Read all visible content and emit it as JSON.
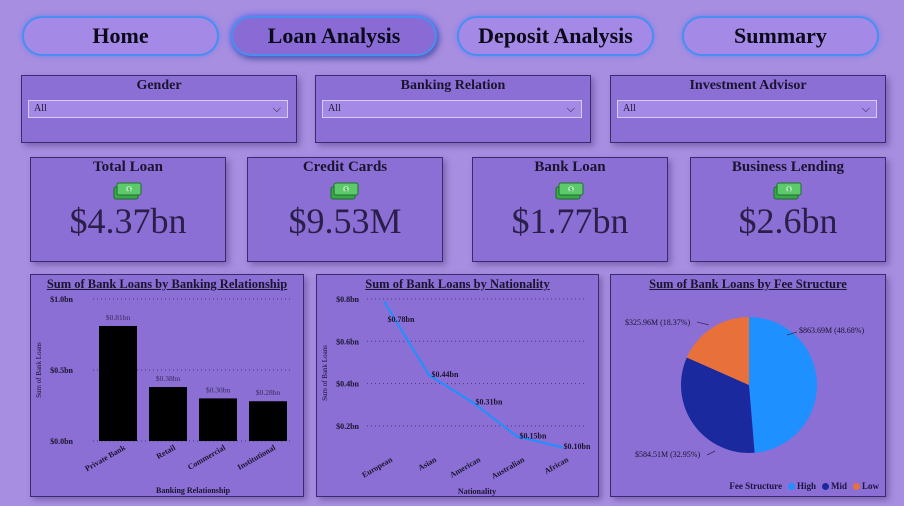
{
  "nav": [
    {
      "label": "Home",
      "active": false
    },
    {
      "label": "Loan Analysis",
      "active": true
    },
    {
      "label": "Deposit Analysis",
      "active": false
    },
    {
      "label": "Summary",
      "active": false
    }
  ],
  "slicers": [
    {
      "title": "Gender",
      "value": "All"
    },
    {
      "title": "Banking Relation",
      "value": "All"
    },
    {
      "title": "Investment Advisor",
      "value": "All"
    }
  ],
  "kpis": [
    {
      "title": "Total Loan",
      "value": "$4.37bn",
      "icon": "money-icon"
    },
    {
      "title": "Credit Cards",
      "value": "$9.53M",
      "icon": "money-icon"
    },
    {
      "title": "Bank Loan",
      "value": "$1.77bn",
      "icon": "money-icon"
    },
    {
      "title": "Business Lending",
      "value": "$2.6bn",
      "icon": "money-icon"
    }
  ],
  "colors": {
    "bar": "#000000",
    "line": "#1e90ff",
    "pie_high": "#1e90ff",
    "pie_mid": "#1a2a9e",
    "pie_low": "#e8703a"
  },
  "chart_data": [
    {
      "type": "bar",
      "title": "Sum of Bank Loans by Banking Relationship",
      "xlabel": "Banking Relationship",
      "ylabel": "Sum of Bank Loans",
      "categories": [
        "Private Bank",
        "Retail",
        "Commercial",
        "Institutional"
      ],
      "values": [
        0.81,
        0.38,
        0.3,
        0.28
      ],
      "data_labels": [
        "$0.81bn",
        "$0.38bn",
        "$0.30bn",
        "$0.28bn"
      ],
      "yticks": [
        "$0.0bn",
        "$0.5bn",
        "$1.0bn"
      ],
      "ylim": [
        0,
        1.0
      ]
    },
    {
      "type": "line",
      "title": "Sum of Bank Loans by Nationality",
      "xlabel": "Nationality",
      "ylabel": "Sum of Bank Loans",
      "categories": [
        "European",
        "Asian",
        "American",
        "Australian",
        "African"
      ],
      "values": [
        0.78,
        0.44,
        0.31,
        0.15,
        0.1
      ],
      "data_labels": [
        "$0.78bn",
        "$0.44bn",
        "$0.31bn",
        "$0.15bn",
        "$0.10bn"
      ],
      "yticks": [
        "$0.2bn",
        "$0.4bn",
        "$0.6bn",
        "$0.8bn"
      ],
      "ylim": [
        0.1,
        0.8
      ]
    },
    {
      "type": "pie",
      "title": "Sum of Bank Loans by Fee Structure",
      "legend_title": "Fee Structure",
      "slices": [
        {
          "name": "High",
          "value": 863.69,
          "label": "$863.69M (48.68%)"
        },
        {
          "name": "Mid",
          "value": 584.51,
          "label": "$584.51M (32.95%)"
        },
        {
          "name": "Low",
          "value": 325.96,
          "label": "$325.96M (18.37%)"
        }
      ]
    }
  ]
}
